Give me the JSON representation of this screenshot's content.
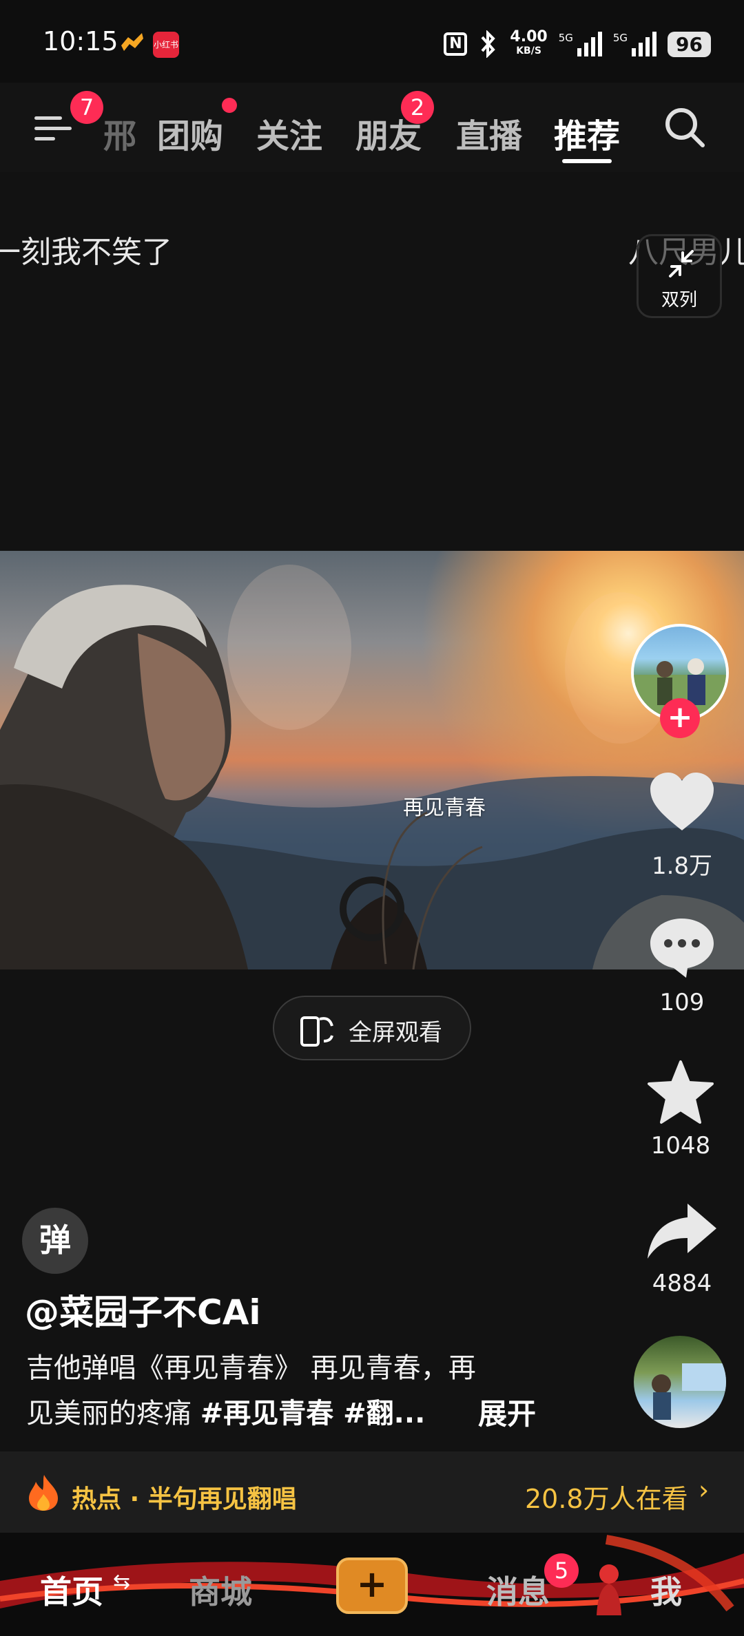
{
  "status_bar": {
    "time": "10:15",
    "app_badge": "小红书",
    "net_speed": "4.00",
    "net_unit": "KB/S",
    "sim1": "5G",
    "sim2": "5G",
    "battery": "96"
  },
  "top_nav": {
    "menu_badge": "7",
    "partial_tab": "邢",
    "tabs": [
      {
        "label": "团购"
      },
      {
        "label": "关注"
      },
      {
        "label": "朋友",
        "badge": "2"
      },
      {
        "label": "直播"
      },
      {
        "label": "推荐",
        "active": true
      }
    ]
  },
  "feed_peek": {
    "left_text": "一刻我不笑了",
    "right_text": "八尺男儿",
    "dual_column_label": "双列"
  },
  "video": {
    "title_overlay": "再见青春",
    "fullscreen_label": "全屏观看"
  },
  "actions": {
    "likes": "1.8万",
    "comments": "109",
    "favorites": "1048",
    "shares": "4884"
  },
  "post": {
    "tanmu_icon": "弹",
    "author": "@菜园子不CAi",
    "caption_line1": "吉他弹唱《再见青春》 再见青春，再",
    "caption_line2_plain": "见美丽的疼痛 ",
    "caption_tags": "#再见青春 #翻...",
    "expand_label": "展开"
  },
  "hot_bar": {
    "text": "热点 · 半句再见翻唱",
    "viewers": "20.8万人在看",
    "chevron": "›"
  },
  "bottom_nav": {
    "home": "首页",
    "mall": "商城",
    "create": "+",
    "messages": "消息",
    "messages_badge": "5",
    "me": "我"
  }
}
